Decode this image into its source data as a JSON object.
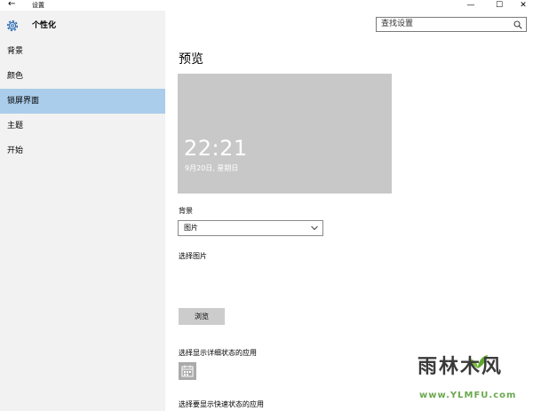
{
  "window": {
    "title": "设置",
    "back_glyph": "←",
    "minimize_glyph": "—",
    "maximize_glyph": "☐",
    "close_glyph": "✕"
  },
  "sidebar": {
    "header_label": "个性化",
    "header_icon": "gear-icon",
    "items": [
      {
        "label": "背景",
        "active": false
      },
      {
        "label": "颜色",
        "active": false
      },
      {
        "label": "锁屏界面",
        "active": true
      },
      {
        "label": "主题",
        "active": false
      },
      {
        "label": "开始",
        "active": false
      }
    ]
  },
  "search": {
    "placeholder": "查找设置",
    "icon": "search-icon"
  },
  "main": {
    "title": "预览",
    "preview": {
      "time": "22:21",
      "date": "9月20日, 星期日"
    },
    "background_label": "背景",
    "background_value": "图片",
    "choose_picture_label": "选择图片",
    "browse_button": "浏览",
    "detailed_status_label": "选择显示详细状态的应用",
    "detailed_status_icon": "calendar-icon",
    "quick_status_label": "选择要显示快速状态的应用"
  },
  "watermark": {
    "name": "雨林木风",
    "url": "www.YLMFU.com"
  },
  "colors": {
    "accent": "#a9cdeb",
    "sidebar_bg": "#f2f2f2",
    "preview_bg": "#c8c8c8",
    "button_bg": "#cccccc"
  }
}
